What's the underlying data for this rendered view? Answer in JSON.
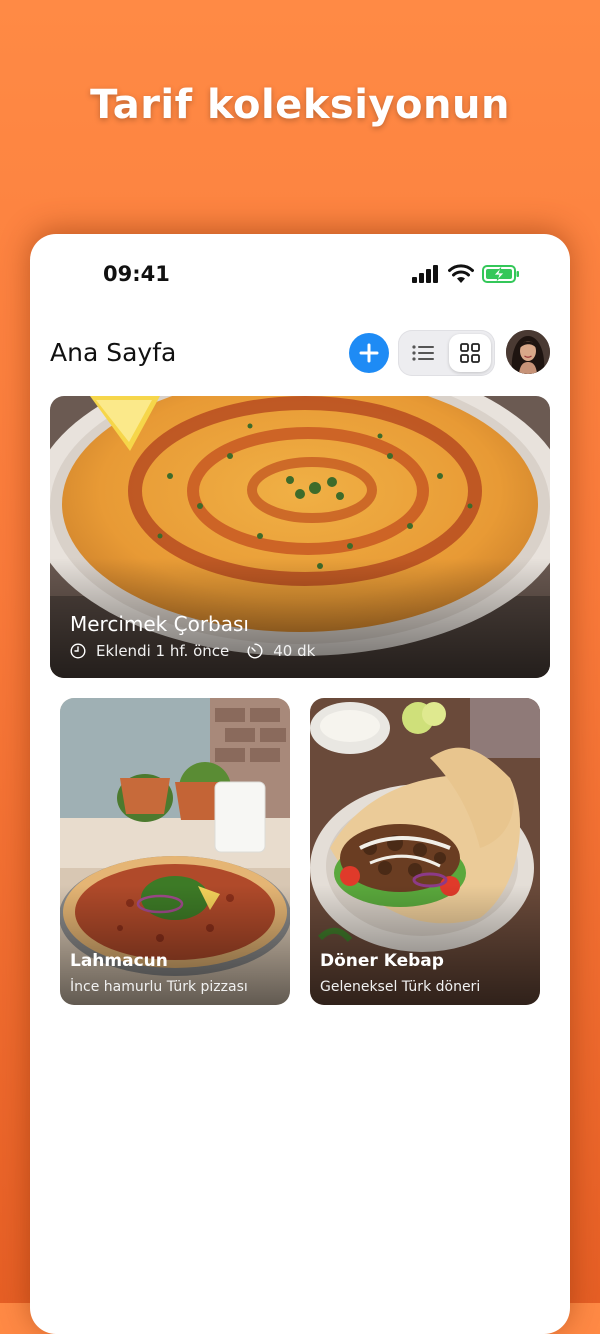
{
  "headline": "Tarif koleksiyonun",
  "status": {
    "time": "09:41"
  },
  "nav": {
    "title": "Ana Sayfa",
    "view_modes": [
      "list",
      "grid"
    ],
    "selected_view": "grid"
  },
  "featured": {
    "title": "Mercimek Çorbası",
    "added": "Eklendi 1 hf. önce",
    "duration": "40 dk"
  },
  "recipes": [
    {
      "title": "Lahmacun",
      "subtitle": "İnce hamurlu Türk pizzası"
    },
    {
      "title": "Döner Kebap",
      "subtitle": "Geleneksel Türk döneri"
    }
  ],
  "colors": {
    "accent": "#1E8BF5",
    "background": "#F97A3A",
    "battery": "#34C759"
  }
}
